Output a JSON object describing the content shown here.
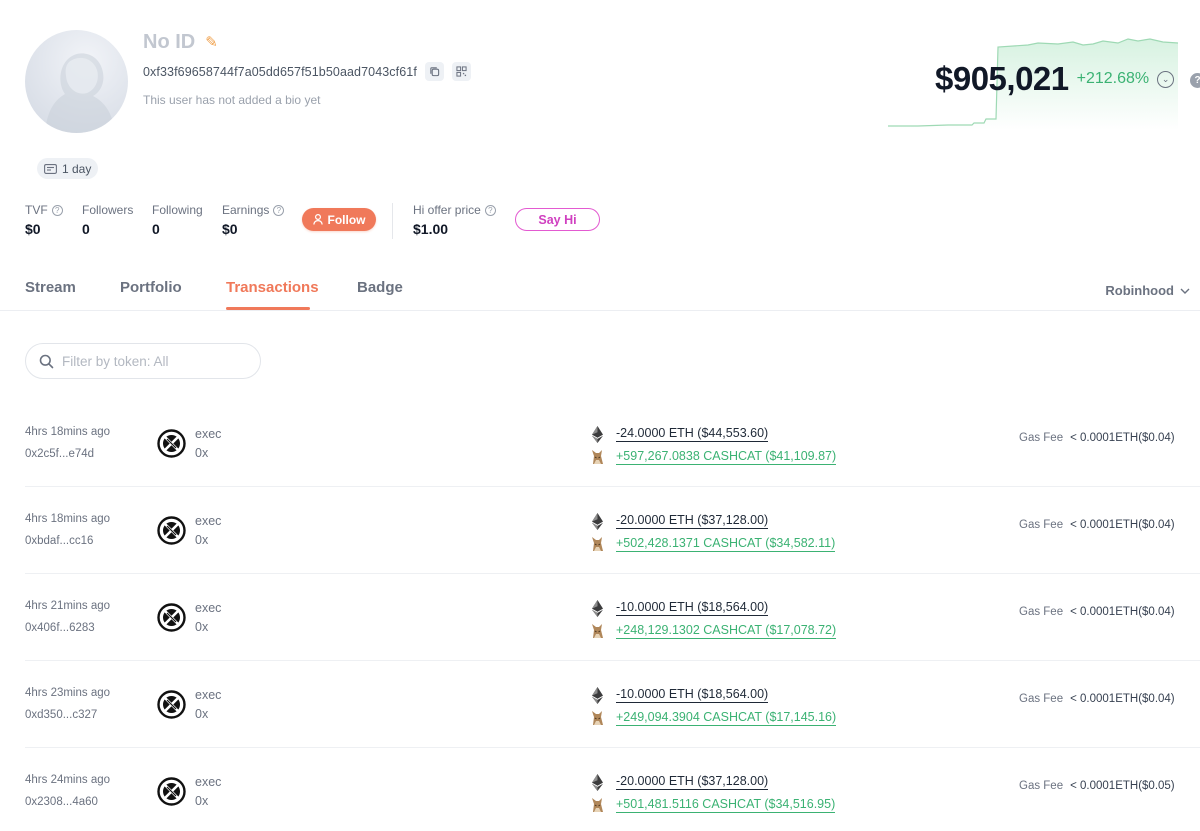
{
  "profile": {
    "name": "No ID",
    "address": "0xf33f69658744f7a05dd657f51b50aad7043cf61f",
    "bio": "This user has not added a bio yet",
    "age": "1 day"
  },
  "networth": {
    "value": "$905,021",
    "change": "+212.68%",
    "accent_color": "#3bb273"
  },
  "stats": [
    {
      "label": "TVF",
      "value": "$0",
      "help": true
    },
    {
      "label": "Followers",
      "value": "0",
      "help": false
    },
    {
      "label": "Following",
      "value": "0",
      "help": false
    },
    {
      "label": "Earnings",
      "value": "$0",
      "help": true
    }
  ],
  "follow_label": "Follow",
  "offer": {
    "label": "Hi offer price",
    "value": "$1.00"
  },
  "sayhi_label": "Say Hi",
  "tabs": [
    {
      "label": "Stream",
      "active": false
    },
    {
      "label": "Portfolio",
      "active": false
    },
    {
      "label": "Transactions",
      "active": true
    },
    {
      "label": "Badge",
      "active": false
    }
  ],
  "network_selector": "Robinhood",
  "filter": {
    "placeholder": "Filter by token: All"
  },
  "gas_label": "Gas Fee",
  "transactions": [
    {
      "time": "4hrs 18mins ago",
      "hash": "0x2c5f...e74d",
      "method": "exec",
      "to": "0x",
      "out": "-24.0000 ETH ($44,553.60)",
      "in": "+597,267.0838 CASHCAT ($41,109.87)",
      "gas": "< 0.0001ETH($0.04)"
    },
    {
      "time": "4hrs 18mins ago",
      "hash": "0xbdaf...cc16",
      "method": "exec",
      "to": "0x",
      "out": "-20.0000 ETH ($37,128.00)",
      "in": "+502,428.1371 CASHCAT ($34,582.11)",
      "gas": "< 0.0001ETH($0.04)"
    },
    {
      "time": "4hrs 21mins ago",
      "hash": "0x406f...6283",
      "method": "exec",
      "to": "0x",
      "out": "-10.0000 ETH ($18,564.00)",
      "in": "+248,129.1302 CASHCAT ($17,078.72)",
      "gas": "< 0.0001ETH($0.04)"
    },
    {
      "time": "4hrs 23mins ago",
      "hash": "0xd350...c327",
      "method": "exec",
      "to": "0x",
      "out": "-10.0000 ETH ($18,564.00)",
      "in": "+249,094.3904 CASHCAT ($17,145.16)",
      "gas": "< 0.0001ETH($0.04)"
    },
    {
      "time": "4hrs 24mins ago",
      "hash": "0x2308...4a60",
      "method": "exec",
      "to": "0x",
      "out": "-20.0000 ETH ($37,128.00)",
      "in": "+501,481.5116 CASHCAT ($34,516.95)",
      "gas": "< 0.0001ETH($0.05)"
    }
  ]
}
